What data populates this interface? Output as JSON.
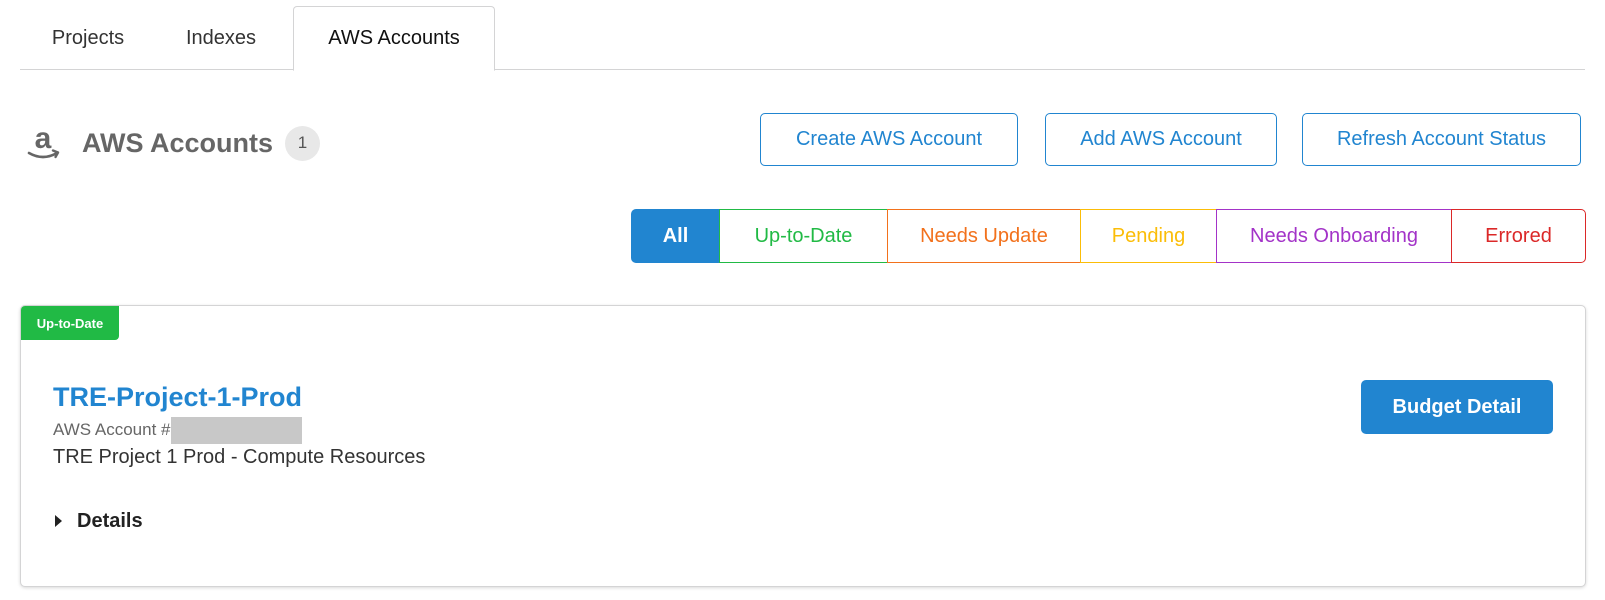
{
  "tabs": [
    {
      "label": "Projects"
    },
    {
      "label": "Indexes"
    },
    {
      "label": "AWS Accounts",
      "active": true
    }
  ],
  "header": {
    "icon": "amazon-icon",
    "title": "AWS Accounts",
    "count": "1"
  },
  "actions": {
    "create": "Create AWS Account",
    "add": "Add AWS Account",
    "refresh": "Refresh Account Status"
  },
  "filters": [
    {
      "label": "All",
      "color": "#2185d0",
      "active": true
    },
    {
      "label": "Up-to-Date",
      "color": "#21ba45"
    },
    {
      "label": "Needs Update",
      "color": "#f2711c"
    },
    {
      "label": "Pending",
      "color": "#fbbd08"
    },
    {
      "label": "Needs Onboarding",
      "color": "#a333c8"
    },
    {
      "label": "Errored",
      "color": "#db2828"
    }
  ],
  "account": {
    "status": "Up-to-Date",
    "status_color": "#21ba45",
    "name": "TRE-Project-1-Prod",
    "number_label": "AWS Account #",
    "description": "TRE Project 1 Prod - Compute Resources",
    "details_label": "Details",
    "budget_button": "Budget Detail"
  }
}
